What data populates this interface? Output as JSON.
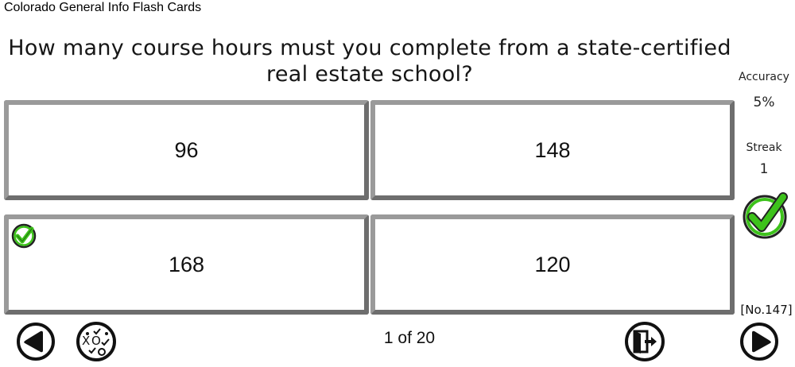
{
  "app_title": "Colorado General Info Flash Cards",
  "question": "How many course hours must you complete from a state-certified real estate school?",
  "answers": [
    {
      "label": "96",
      "correct": false
    },
    {
      "label": "148",
      "correct": false
    },
    {
      "label": "168",
      "correct": true
    },
    {
      "label": "120",
      "correct": false
    }
  ],
  "stats": {
    "accuracy_label": "Accuracy",
    "accuracy_value": "5%",
    "streak_label": "Streak",
    "streak_value": "1"
  },
  "card_number": "[No.147]",
  "progress": "1 of 20",
  "icons": {
    "prev": "arrow-left-circle-icon",
    "quiz": "tic-tac-toe-icon",
    "exit": "exit-door-icon",
    "next": "arrow-right-circle-icon",
    "correct": "green-check-icon"
  },
  "colors": {
    "check_green": "#3dc21b",
    "card_border": "#8a8a8a"
  }
}
